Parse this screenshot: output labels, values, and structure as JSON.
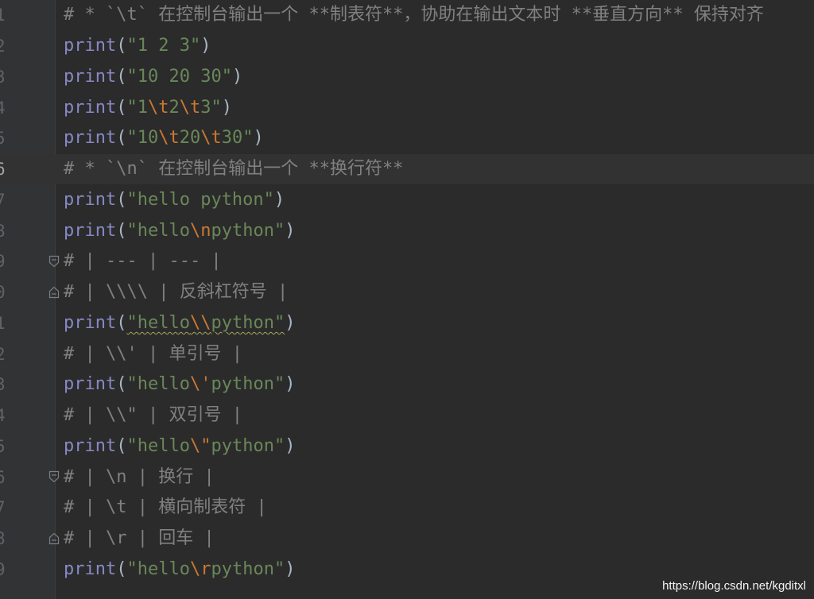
{
  "lines": [
    {
      "num": "1",
      "parts": [
        {
          "t": "c",
          "v": "# * `\\t` 在控制台输出一个 **制表符**，协助在输出文本时 **垂直方向** 保持对齐"
        }
      ]
    },
    {
      "num": "2",
      "parts": [
        {
          "t": "f",
          "v": "print"
        },
        {
          "t": "p",
          "v": "("
        },
        {
          "t": "s",
          "v": "\"1 2 3\""
        },
        {
          "t": "p",
          "v": ")"
        }
      ]
    },
    {
      "num": "3",
      "parts": [
        {
          "t": "f",
          "v": "print"
        },
        {
          "t": "p",
          "v": "("
        },
        {
          "t": "s",
          "v": "\"10 20 30\""
        },
        {
          "t": "p",
          "v": ")"
        }
      ]
    },
    {
      "num": "4",
      "parts": [
        {
          "t": "f",
          "v": "print"
        },
        {
          "t": "p",
          "v": "("
        },
        {
          "t": "s",
          "v": "\"1"
        },
        {
          "t": "e",
          "v": "\\t"
        },
        {
          "t": "s",
          "v": "2"
        },
        {
          "t": "e",
          "v": "\\t"
        },
        {
          "t": "s",
          "v": "3\""
        },
        {
          "t": "p",
          "v": ")"
        }
      ]
    },
    {
      "num": "5",
      "parts": [
        {
          "t": "f",
          "v": "print"
        },
        {
          "t": "p",
          "v": "("
        },
        {
          "t": "s",
          "v": "\"10"
        },
        {
          "t": "e",
          "v": "\\t"
        },
        {
          "t": "s",
          "v": "20"
        },
        {
          "t": "e",
          "v": "\\t"
        },
        {
          "t": "s",
          "v": "30\""
        },
        {
          "t": "p",
          "v": ")"
        }
      ]
    },
    {
      "num": "6",
      "current": true,
      "parts": [
        {
          "t": "c",
          "v": "# * `\\n` 在控制台输出一个 **换行符**"
        }
      ]
    },
    {
      "num": "7",
      "parts": [
        {
          "t": "f",
          "v": "print"
        },
        {
          "t": "p",
          "v": "("
        },
        {
          "t": "s",
          "v": "\"hello python\""
        },
        {
          "t": "p",
          "v": ")"
        }
      ]
    },
    {
      "num": "8",
      "parts": [
        {
          "t": "f",
          "v": "print"
        },
        {
          "t": "p",
          "v": "("
        },
        {
          "t": "s",
          "v": "\"hello"
        },
        {
          "t": "e",
          "v": "\\n"
        },
        {
          "t": "s",
          "v": "python\""
        },
        {
          "t": "p",
          "v": ")"
        }
      ]
    },
    {
      "num": "9",
      "fold": "open",
      "parts": [
        {
          "t": "c",
          "v": "# | --- | --- |"
        }
      ]
    },
    {
      "num": "0",
      "fold": "close",
      "parts": [
        {
          "t": "c",
          "v": "# | \\\\\\\\ | 反斜杠符号 |"
        }
      ]
    },
    {
      "num": "1",
      "parts": [
        {
          "t": "f",
          "v": "print"
        },
        {
          "t": "p",
          "v": "("
        },
        {
          "t": "sq",
          "v": "\"hello"
        },
        {
          "t": "eq",
          "v": "\\\\"
        },
        {
          "t": "sq",
          "v": "python\""
        },
        {
          "t": "p",
          "v": ")"
        }
      ]
    },
    {
      "num": "2",
      "parts": [
        {
          "t": "c",
          "v": "# | \\\\' | 单引号 |"
        }
      ]
    },
    {
      "num": "3",
      "parts": [
        {
          "t": "f",
          "v": "print"
        },
        {
          "t": "p",
          "v": "("
        },
        {
          "t": "s",
          "v": "\"hello"
        },
        {
          "t": "e",
          "v": "\\'"
        },
        {
          "t": "s",
          "v": "python\""
        },
        {
          "t": "p",
          "v": ")"
        }
      ]
    },
    {
      "num": "4",
      "parts": [
        {
          "t": "c",
          "v": "# | \\\\\" | 双引号 |"
        }
      ]
    },
    {
      "num": "5",
      "parts": [
        {
          "t": "f",
          "v": "print"
        },
        {
          "t": "p",
          "v": "("
        },
        {
          "t": "s",
          "v": "\"hello"
        },
        {
          "t": "e",
          "v": "\\\""
        },
        {
          "t": "s",
          "v": "python\""
        },
        {
          "t": "p",
          "v": ")"
        }
      ]
    },
    {
      "num": "6",
      "fold": "open",
      "parts": [
        {
          "t": "c",
          "v": "# | \\n | 换行 |"
        }
      ]
    },
    {
      "num": "7",
      "parts": [
        {
          "t": "c",
          "v": "# | \\t | 横向制表符 |"
        }
      ]
    },
    {
      "num": "8",
      "fold": "close",
      "parts": [
        {
          "t": "c",
          "v": "# | \\r | 回车 |"
        }
      ]
    },
    {
      "num": "9",
      "parts": [
        {
          "t": "f",
          "v": "print"
        },
        {
          "t": "p",
          "v": "("
        },
        {
          "t": "s",
          "v": "\"hello"
        },
        {
          "t": "e",
          "v": "\\r"
        },
        {
          "t": "s",
          "v": "python\""
        },
        {
          "t": "p",
          "v": ")"
        }
      ]
    }
  ],
  "watermark": "https://blog.csdn.net/kgditxl",
  "colors": {
    "background": "#2b2b2b",
    "gutter": "#313335",
    "function": "#8888c6",
    "string": "#6a8759",
    "escape": "#cc7832",
    "comment": "#808080",
    "punctuation": "#a9b7c6"
  }
}
